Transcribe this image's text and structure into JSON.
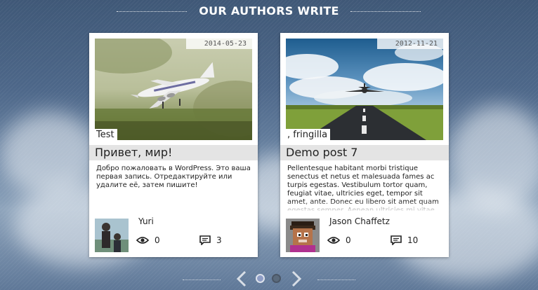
{
  "section": {
    "title": "OUR AUTHORS WRITE"
  },
  "posts": [
    {
      "date": "2014-05-23",
      "tag": "Test",
      "title": "Привет, мир!",
      "excerpt": "Добро пожаловать в WordPress. Это ваша первая запись. Отредактируйте или удалите её, затем пишите!",
      "author": "Yuri",
      "views": "0",
      "comments": "3"
    },
    {
      "date": "2012-11-21",
      "tag": ", fringilla",
      "title": "Demo post 7",
      "excerpt": "Pellentesque habitant morbi tristique senectus et netus et malesuada fames ac turpis egestas. Vestibulum tortor quam, feugiat vitae, ultricies eget, tempor sit amet, ante. Donec eu libero sit amet quam egestas semper. Aenean ultricies mi vitae est.",
      "author": "Jason Chaffetz",
      "views": "0",
      "comments": "10"
    }
  ],
  "pager": {
    "pages": 2,
    "current": 1
  },
  "colors": {
    "accent_dot": "#8e9dc6",
    "inactive_dot": "#5a6a7c",
    "arrow": "#d8dee6"
  },
  "icons": {
    "views": "eye-icon",
    "comments": "comment-icon",
    "prev": "chevron-left-icon",
    "next": "chevron-right-icon"
  }
}
